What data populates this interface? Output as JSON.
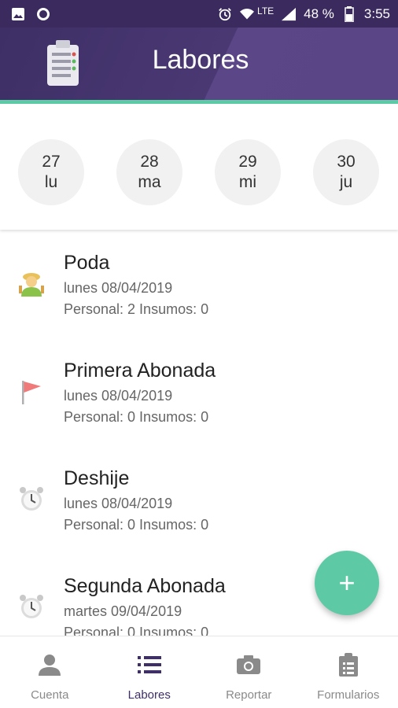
{
  "status_bar": {
    "network": "LTE",
    "battery": "48 %",
    "time": "3:55"
  },
  "header": {
    "title": "Labores"
  },
  "dates": [
    {
      "day": "27",
      "weekday": "lu"
    },
    {
      "day": "28",
      "weekday": "ma"
    },
    {
      "day": "29",
      "weekday": "mi"
    },
    {
      "day": "30",
      "weekday": "ju"
    }
  ],
  "tasks": [
    {
      "title": "Poda",
      "date": "lunes 08/04/2019",
      "stats": "Personal: 2 Insumos: 0",
      "icon": "farmer-icon"
    },
    {
      "title": "Primera Abonada",
      "date": "lunes 08/04/2019",
      "stats": "Personal: 0 Insumos: 0",
      "icon": "flag-icon"
    },
    {
      "title": "Deshije",
      "date": "lunes 08/04/2019",
      "stats": "Personal: 0 Insumos: 0",
      "icon": "alarm-clock-icon"
    },
    {
      "title": "Segunda Abonada",
      "date": "martes 09/04/2019",
      "stats": "Personal: 0 Insumos: 0",
      "icon": "alarm-clock-icon"
    }
  ],
  "fab": {
    "label": "+"
  },
  "bottom_nav": [
    {
      "label": "Cuenta",
      "icon": "account-icon",
      "active": false
    },
    {
      "label": "Labores",
      "icon": "list-icon",
      "active": true
    },
    {
      "label": "Reportar",
      "icon": "camera-icon",
      "active": false
    },
    {
      "label": "Formularios",
      "icon": "clipboard-icon",
      "active": false
    }
  ],
  "colors": {
    "primary": "#3e2f66",
    "accent": "#5ecaa5",
    "status_bar": "#3b2a5e"
  }
}
